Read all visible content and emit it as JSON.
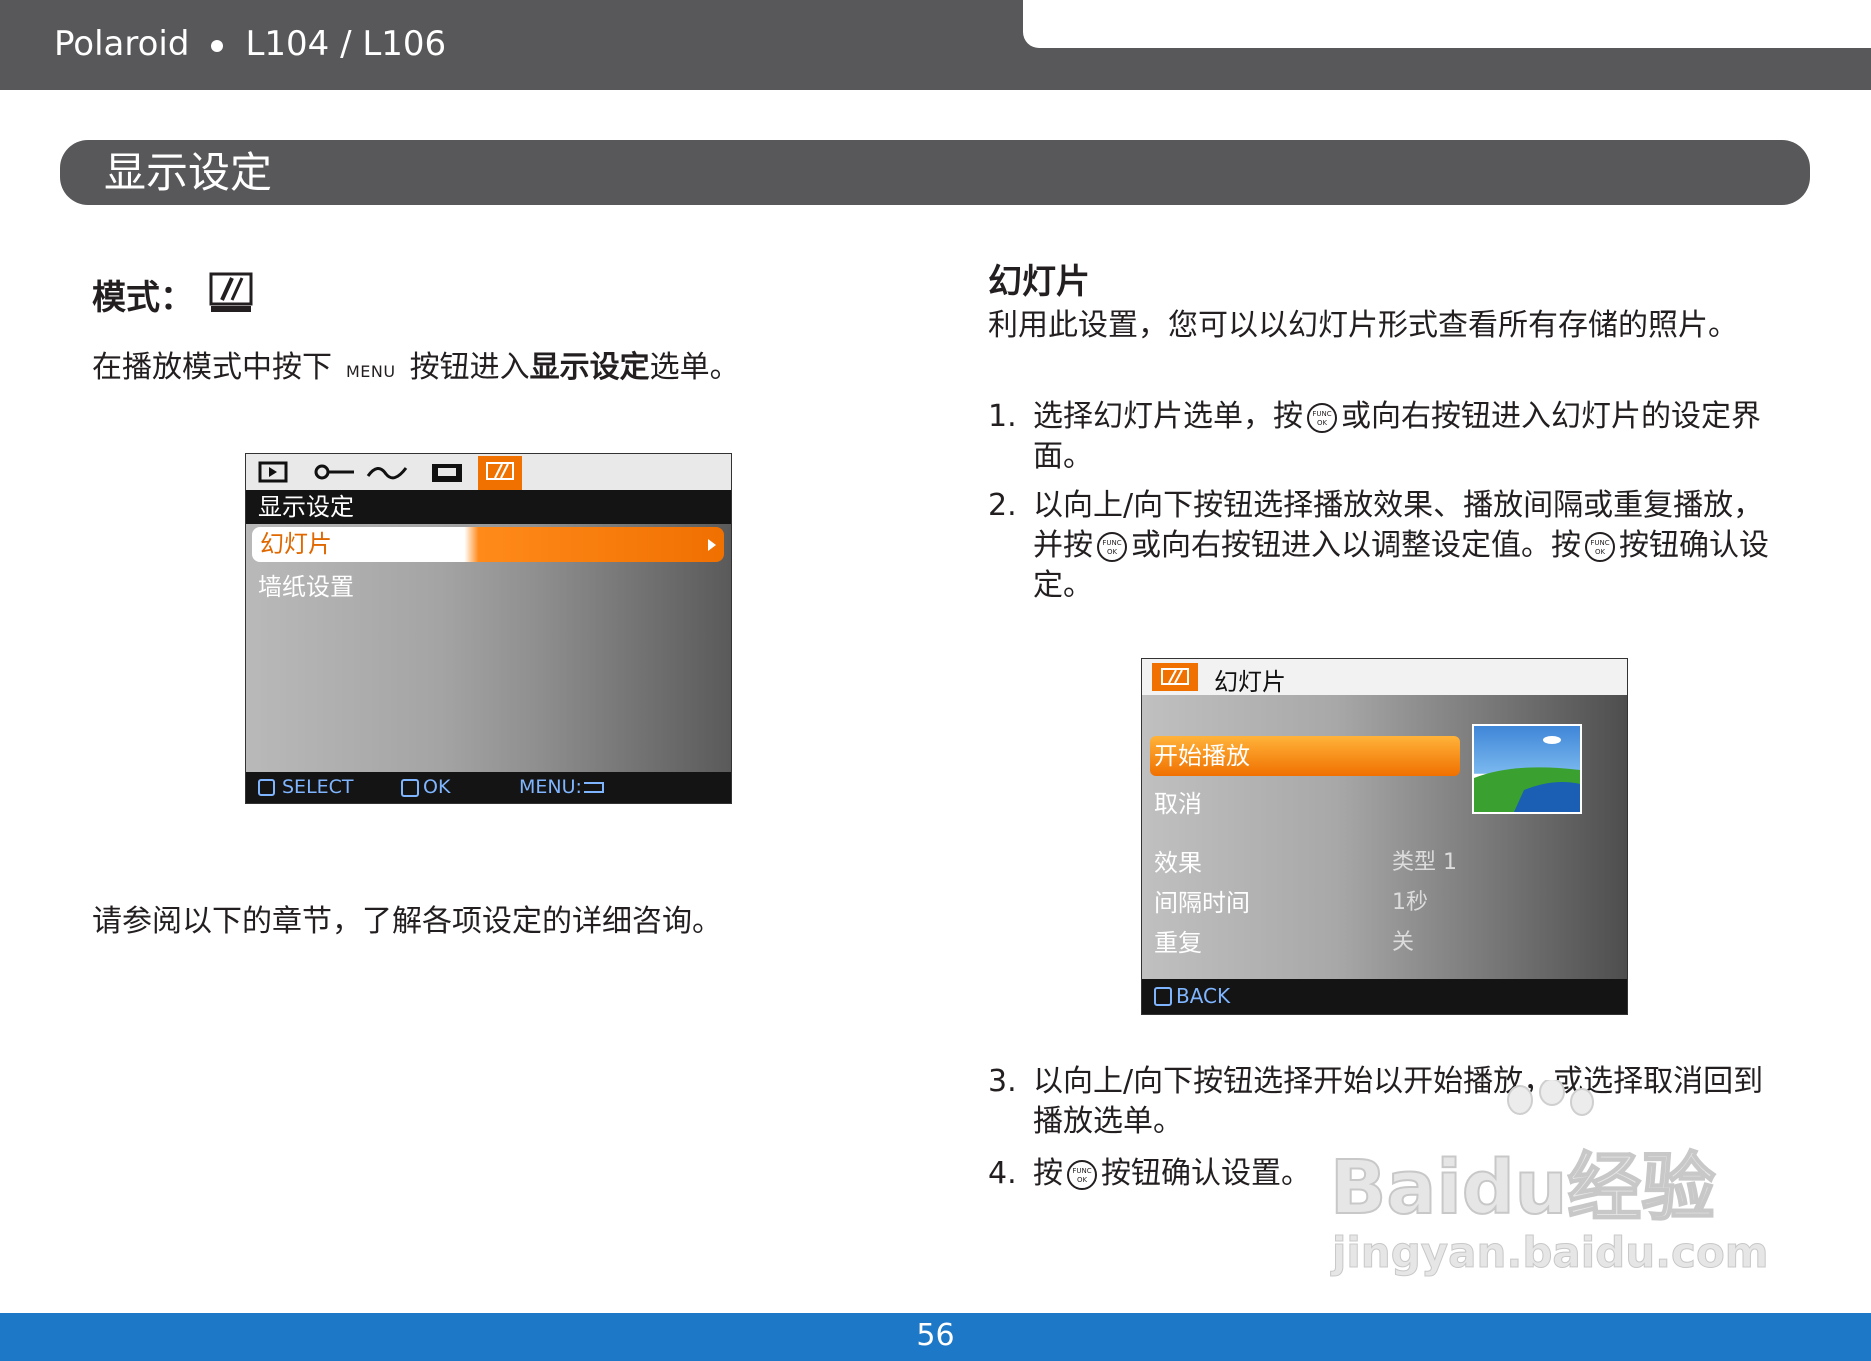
{
  "header": {
    "brand": "Polaroid",
    "model": "L104 / L106"
  },
  "section": {
    "title": "显示设定"
  },
  "left": {
    "mode_label": "模式：",
    "para1": {
      "before": "在播放模式中按下",
      "menu_key": "MENU",
      "after": "按钮进入",
      "bold": "显示设定",
      "end": "选单。"
    },
    "para2": "请参阅以下的章节，了解各项设定的详细咨询。",
    "screen": {
      "title": "显示设定",
      "items": [
        "幻灯片",
        "墙纸设置"
      ],
      "bottom": {
        "select": "SELECT",
        "ok": "OK",
        "menu": "MENU:"
      }
    }
  },
  "right": {
    "heading": "幻灯片",
    "intro": "利用此设置，您可以以幻灯片形式查看所有存储的照片。",
    "func_text": {
      "top": "FUNC",
      "bottom": "OK"
    },
    "steps": [
      {
        "num": "1.",
        "a": "选择幻灯片选单，按",
        "b": "或向右按钮进入幻灯片的设定界面。"
      },
      {
        "num": "2.",
        "a": "以向上/向下按钮选择播放效果、播放间隔或重复播放，并按",
        "b": "或向右按钮进入以调整设定值。按",
        "c": "按钮确认设定。"
      },
      {
        "num": "3.",
        "a": "以向上/向下按钮选择开始以开始播放，或选择取消回到播放选单。"
      },
      {
        "num": "4.",
        "a": "按",
        "b": "按钮确认设置。"
      }
    ],
    "screen": {
      "title": "幻灯片",
      "items": [
        "开始播放",
        "取消"
      ],
      "settings": [
        {
          "label": "效果",
          "value": "类型 1"
        },
        {
          "label": "间隔时间",
          "value": "1秒"
        },
        {
          "label": "重复",
          "value": "关"
        }
      ],
      "back": "BACK"
    }
  },
  "watermark": {
    "main": "Baidu经验",
    "sub": "jingyan.baidu.com"
  },
  "footer": {
    "page": "56"
  }
}
